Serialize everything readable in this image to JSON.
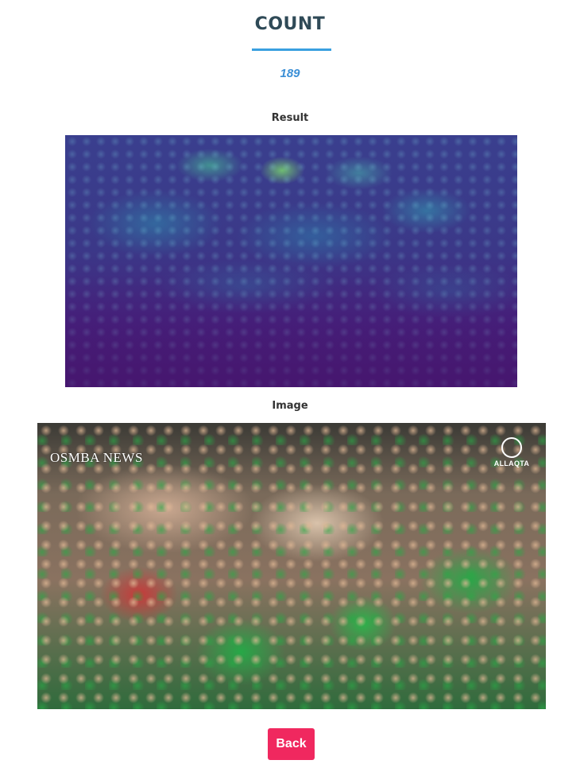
{
  "header": {
    "title": "COUNT",
    "count_value": "189"
  },
  "result_section": {
    "label": "Result"
  },
  "image_section": {
    "label": "Image",
    "watermark_left": "OSMBA NEWS",
    "watermark_right": "ALLAQTA"
  },
  "actions": {
    "back_label": "Back"
  },
  "colors": {
    "title": "#2f4a57",
    "accent_underline": "#3aa0e0",
    "count_value": "#3b8fd6",
    "back_button": "#f0285f"
  }
}
